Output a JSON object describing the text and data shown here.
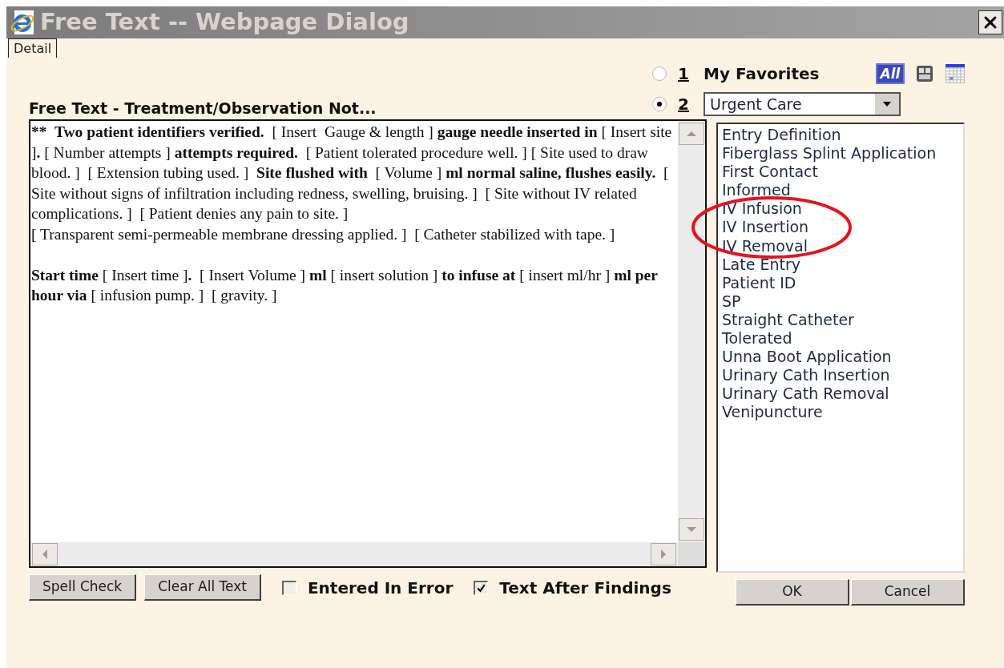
{
  "window": {
    "title": "Free Text -- Webpage Dialog"
  },
  "tabs": [
    {
      "label": "Detail",
      "selected": true
    }
  ],
  "note_title": "Free Text - Treatment/Observation Not...",
  "note": {
    "lead": "**  Two patient identifiers verified.",
    "text": "  [ Insert  Gauge & length ] **gauge needle inserted in** [ Insert site ]**.** [ Number attempts ] **attempts required.**  [ Patient tolerated procedure well. ] [ Site used to draw blood. ]  [ Extension tubing used. ]  **Site flushed with**  [ Volume ] **ml normal saline, flushes easily.**  [ Site without signs of infiltration including redness, swelling, bruising. ]  [ Site without IV related complications. ]  [ Patient denies any pain to site. ]\n[ Transparent semi-permeable membrane dressing applied. ]  [ Catheter stabilized with tape. ]\n\n**Start time** [ Insert time ]**.**  [ Insert Volume ] **ml** [ insert solution ] **to infuse at** [ insert ml/hr ] **ml per hour via** [ infusion pump. ]  [ gravity. ]"
  },
  "sources": [
    {
      "kind": "label",
      "number": "1",
      "label": "My Favorites",
      "selected": false
    },
    {
      "kind": "dropdown",
      "number": "2",
      "value": "Urgent Care",
      "selected": true
    }
  ],
  "all_button": "All",
  "list_items": [
    {
      "label": "Entry Definition"
    },
    {
      "label": "Fiberglass Splint Application"
    },
    {
      "label": "First Contact"
    },
    {
      "label": "Informed"
    },
    {
      "label": "IV Infusion"
    },
    {
      "label": "IV Insertion"
    },
    {
      "label": "IV Removal"
    },
    {
      "label": "Late Entry"
    },
    {
      "label": "Patient ID"
    },
    {
      "label": "SP"
    },
    {
      "label": "Straight Catheter"
    },
    {
      "label": "Tolerated"
    },
    {
      "label": "Unna Boot Application"
    },
    {
      "label": "Urinary Cath Insertion"
    },
    {
      "label": "Urinary Cath Removal"
    },
    {
      "label": "Venipuncture"
    }
  ],
  "action_buttons": [
    "Spell Check",
    "Clear All Text"
  ],
  "checkboxes": [
    {
      "label": "Entered In Error",
      "checked": false
    },
    {
      "label": "Text After Findings",
      "checked": true
    }
  ],
  "dialog_buttons": [
    "OK",
    "Cancel"
  ]
}
